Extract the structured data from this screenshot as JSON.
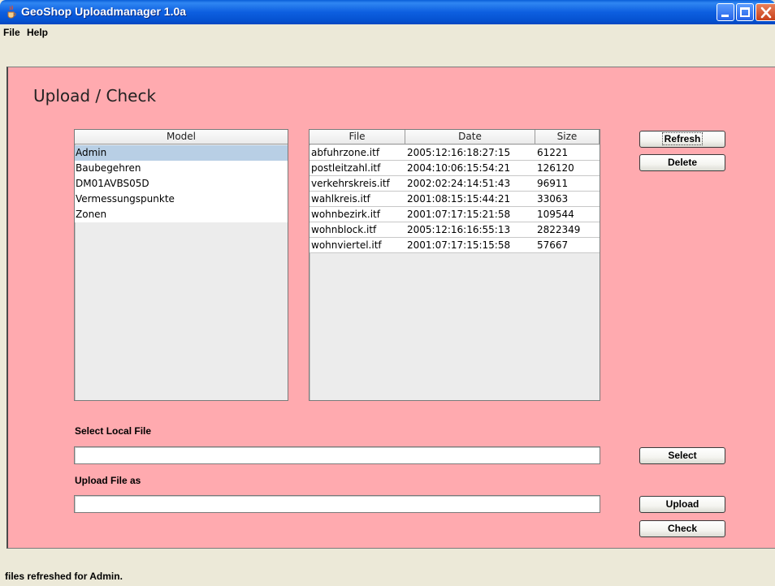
{
  "window": {
    "title": "GeoShop Uploadmanager 1.0a",
    "icon": "java-cup-icon"
  },
  "menu": [
    "File",
    "Help"
  ],
  "page": {
    "title": "Upload / Check"
  },
  "models": {
    "header": "Model",
    "items": [
      "Admin",
      "Baubegehren",
      "DM01AVBS05D",
      "Vermessungspunkte",
      "Zonen"
    ],
    "selected_index": 0
  },
  "files": {
    "columns": [
      "File",
      "Date",
      "Size"
    ],
    "rows": [
      [
        "abfuhrzone.itf",
        "2005:12:16:18:27:15",
        "61221"
      ],
      [
        "postleitzahl.itf",
        "2004:10:06:15:54:21",
        "126120"
      ],
      [
        "verkehrskreis.itf",
        "2002:02:24:14:51:43",
        "96911"
      ],
      [
        "wahlkreis.itf",
        "2001:08:15:15:44:21",
        "33063"
      ],
      [
        "wohnbezirk.itf",
        "2001:07:17:15:21:58",
        "109544"
      ],
      [
        "wohnblock.itf",
        "2005:12:16:16:55:13",
        "2822349"
      ],
      [
        "wohnviertel.itf",
        "2001:07:17:15:15:58",
        "57667"
      ]
    ]
  },
  "buttons": {
    "refresh": "Refresh",
    "delete": "Delete",
    "select": "Select",
    "upload": "Upload",
    "check": "Check"
  },
  "local_file": {
    "label": "Select Local File",
    "value": ""
  },
  "upload_as": {
    "label": "Upload File as",
    "value": ""
  },
  "status": "files refreshed for Admin.",
  "colors": {
    "panel_background": "#ffaaaf",
    "selection": "#b8cfe5",
    "titlebar": "#0d5fe0"
  }
}
